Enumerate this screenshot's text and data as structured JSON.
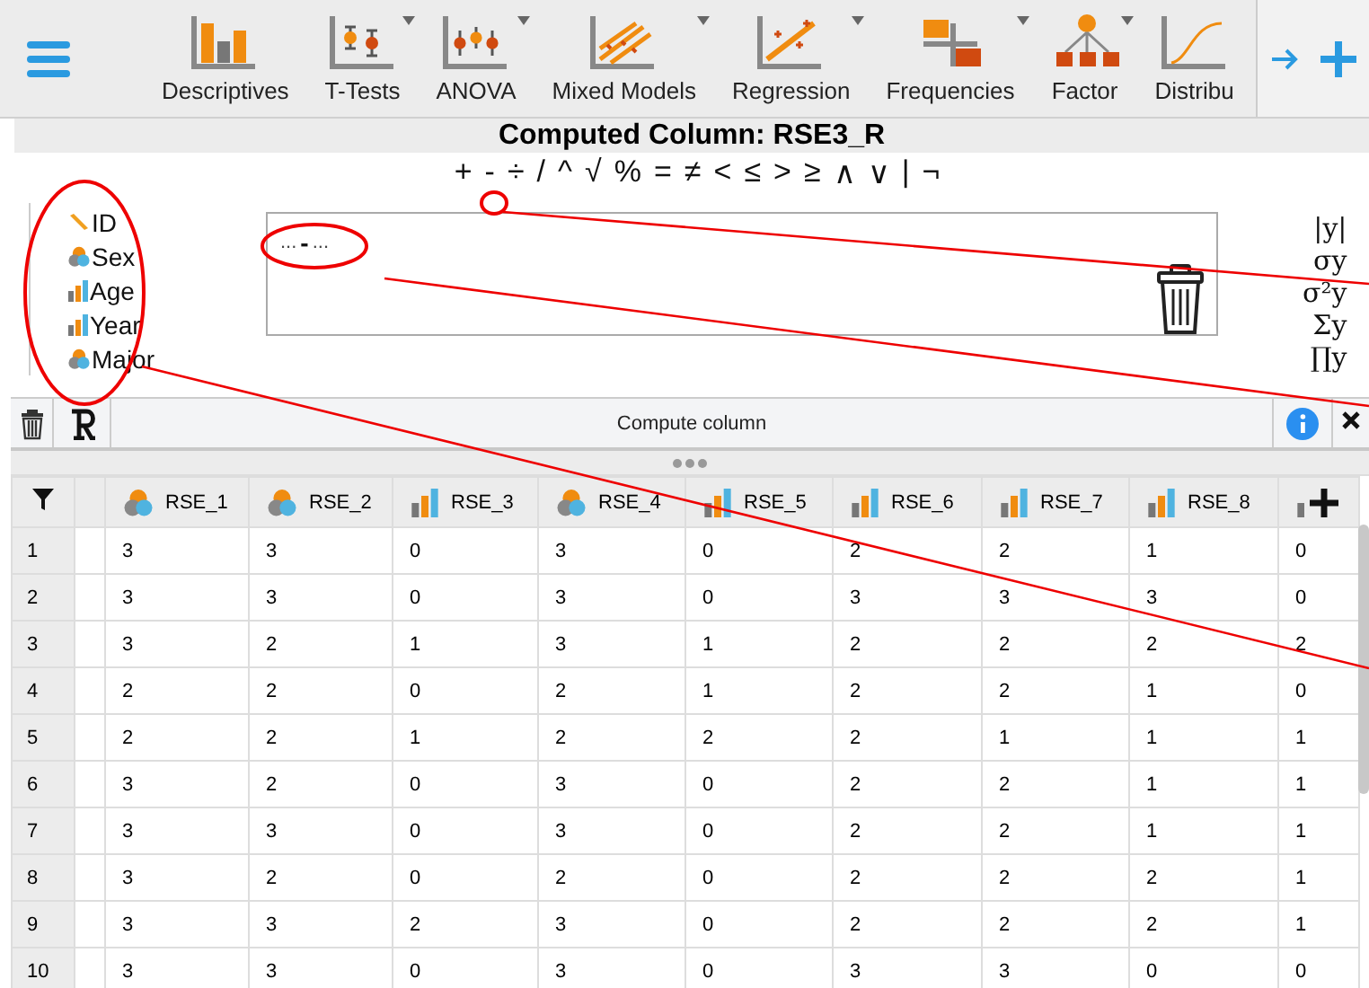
{
  "toolbar": {
    "items": [
      {
        "label": "Descriptives",
        "menu": false
      },
      {
        "label": "T-Tests",
        "menu": true
      },
      {
        "label": "ANOVA",
        "menu": true
      },
      {
        "label": "Mixed Models",
        "menu": true
      },
      {
        "label": "Regression",
        "menu": true
      },
      {
        "label": "Frequencies",
        "menu": true
      },
      {
        "label": "Factor",
        "menu": true
      },
      {
        "label": "Distribu",
        "menu": false
      }
    ]
  },
  "computed_column": {
    "title": "Computed Column: RSE3_R",
    "operators": [
      "+",
      "-",
      "÷",
      "/",
      "^",
      "√",
      "%",
      "=",
      "≠",
      "<",
      "≤",
      ">",
      "≥",
      "∧",
      "∨",
      "|",
      "¬"
    ],
    "variables": [
      {
        "name": "ID",
        "kind": "text"
      },
      {
        "name": "Sex",
        "kind": "nominal"
      },
      {
        "name": "Age",
        "kind": "scale"
      },
      {
        "name": "Year",
        "kind": "scale"
      },
      {
        "name": "Major",
        "kind": "nominal"
      }
    ],
    "formula": {
      "left": "...",
      "operator": "-",
      "right": "..."
    },
    "functions": [
      "|y|",
      "σy",
      "σ²y",
      "Σy",
      "∏y"
    ],
    "compute_button": "Compute column"
  },
  "table": {
    "columns": [
      {
        "name": "RSE_1",
        "kind": "nominal"
      },
      {
        "name": "RSE_2",
        "kind": "nominal"
      },
      {
        "name": "RSE_3",
        "kind": "scale"
      },
      {
        "name": "RSE_4",
        "kind": "nominal"
      },
      {
        "name": "RSE_5",
        "kind": "scale"
      },
      {
        "name": "RSE_6",
        "kind": "scale"
      },
      {
        "name": "RSE_7",
        "kind": "scale"
      },
      {
        "name": "RSE_8",
        "kind": "scale"
      },
      {
        "kind": "scale"
      }
    ],
    "rows": [
      {
        "row": "1",
        "cells": [
          "3",
          "3",
          "0",
          "3",
          "0",
          "2",
          "2",
          "1",
          "0"
        ]
      },
      {
        "row": "2",
        "cells": [
          "3",
          "3",
          "0",
          "3",
          "0",
          "3",
          "3",
          "3",
          "0"
        ]
      },
      {
        "row": "3",
        "cells": [
          "3",
          "2",
          "1",
          "3",
          "1",
          "2",
          "2",
          "2",
          "2"
        ]
      },
      {
        "row": "4",
        "cells": [
          "2",
          "2",
          "0",
          "2",
          "1",
          "2",
          "2",
          "1",
          "0"
        ]
      },
      {
        "row": "5",
        "cells": [
          "2",
          "2",
          "1",
          "2",
          "2",
          "2",
          "1",
          "1",
          "1"
        ]
      },
      {
        "row": "6",
        "cells": [
          "3",
          "2",
          "0",
          "3",
          "0",
          "2",
          "2",
          "1",
          "1"
        ]
      },
      {
        "row": "7",
        "cells": [
          "3",
          "3",
          "0",
          "3",
          "0",
          "2",
          "2",
          "1",
          "1"
        ]
      },
      {
        "row": "8",
        "cells": [
          "3",
          "2",
          "0",
          "2",
          "0",
          "2",
          "2",
          "2",
          "1"
        ]
      },
      {
        "row": "9",
        "cells": [
          "3",
          "3",
          "2",
          "3",
          "0",
          "2",
          "2",
          "2",
          "1"
        ]
      },
      {
        "row": "10",
        "cells": [
          "3",
          "3",
          "0",
          "3",
          "0",
          "3",
          "3",
          "0",
          "0"
        ]
      }
    ]
  }
}
